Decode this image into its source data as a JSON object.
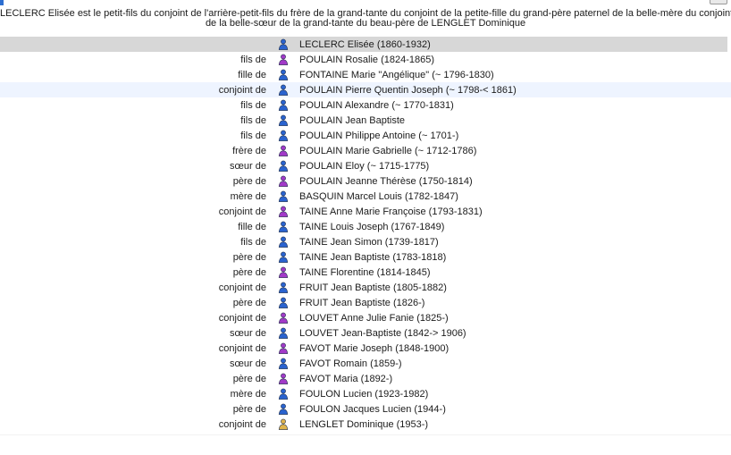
{
  "summary": {
    "line1": "LECLERC Elisée est le petit-fils du conjoint de l'arrière-petit-fils du frère de la grand-tante du conjoint de la petite-fille du grand-père paternel de la belle-mère du conjoint",
    "line2": "de la belle-sœur de la grand-tante du beau-père de LENGLET Dominique"
  },
  "colors": {
    "male_icon": "#2a63cf",
    "female_icon": "#a23ac8",
    "gold_icon": "#e0b54d",
    "selected_row": "#d7d7d7",
    "hover_row": "#eef4ff"
  },
  "rows": [
    {
      "relation": "",
      "name": "LECLERC Elisée (1860-1932)",
      "icon": "male-person-icon",
      "state": "selected"
    },
    {
      "relation": "fils de",
      "name": "POULAIN Rosalie (1824-1865)",
      "icon": "female-person-icon",
      "state": ""
    },
    {
      "relation": "fille de",
      "name": "FONTAINE Marie \"Angélique\" (~ 1796-1830)",
      "icon": "male-person-icon",
      "state": ""
    },
    {
      "relation": "conjoint de",
      "name": "POULAIN Pierre Quentin Joseph (~ 1798-< 1861)",
      "icon": "male-person-icon",
      "state": "hovered"
    },
    {
      "relation": "fils de",
      "name": "POULAIN Alexandre (~ 1770-1831)",
      "icon": "male-person-icon",
      "state": ""
    },
    {
      "relation": "fils de",
      "name": "POULAIN Jean Baptiste",
      "icon": "male-person-icon",
      "state": ""
    },
    {
      "relation": "fils de",
      "name": "POULAIN Philippe Antoine (~ 1701-)",
      "icon": "male-person-icon",
      "state": ""
    },
    {
      "relation": "frère de",
      "name": "POULAIN Marie Gabrielle (~ 1712-1786)",
      "icon": "female-person-icon",
      "state": ""
    },
    {
      "relation": "sœur de",
      "name": "POULAIN Eloy (~ 1715-1775)",
      "icon": "male-person-icon",
      "state": ""
    },
    {
      "relation": "père de",
      "name": "POULAIN Jeanne Thérèse (1750-1814)",
      "icon": "female-person-icon",
      "state": ""
    },
    {
      "relation": "mère de",
      "name": "BASQUIN Marcel Louis (1782-1847)",
      "icon": "male-person-icon",
      "state": ""
    },
    {
      "relation": "conjoint de",
      "name": "TAINE Anne Marie Françoise (1793-1831)",
      "icon": "female-person-icon",
      "state": ""
    },
    {
      "relation": "fille de",
      "name": "TAINE Louis Joseph (1767-1849)",
      "icon": "male-person-icon",
      "state": ""
    },
    {
      "relation": "fils de",
      "name": "TAINE Jean Simon (1739-1817)",
      "icon": "male-person-icon",
      "state": ""
    },
    {
      "relation": "père de",
      "name": "TAINE Jean Baptiste (1783-1818)",
      "icon": "male-person-icon",
      "state": ""
    },
    {
      "relation": "père de",
      "name": "TAINE Florentine (1814-1845)",
      "icon": "female-person-icon",
      "state": ""
    },
    {
      "relation": "conjoint de",
      "name": "FRUIT Jean Baptiste (1805-1882)",
      "icon": "male-person-icon",
      "state": ""
    },
    {
      "relation": "père de",
      "name": "FRUIT Jean Baptiste (1826-)",
      "icon": "male-person-icon",
      "state": ""
    },
    {
      "relation": "conjoint de",
      "name": "LOUVET Anne Julie Fanie (1825-)",
      "icon": "female-person-icon",
      "state": ""
    },
    {
      "relation": "sœur de",
      "name": "LOUVET Jean-Baptiste (1842-> 1906)",
      "icon": "male-person-icon",
      "state": ""
    },
    {
      "relation": "conjoint de",
      "name": "FAVOT Marie Joseph (1848-1900)",
      "icon": "female-person-icon",
      "state": ""
    },
    {
      "relation": "sœur de",
      "name": "FAVOT Romain (1859-)",
      "icon": "male-person-icon",
      "state": ""
    },
    {
      "relation": "père de",
      "name": "FAVOT Maria (1892-)",
      "icon": "female-person-icon",
      "state": ""
    },
    {
      "relation": "mère de",
      "name": "FOULON Lucien (1923-1982)",
      "icon": "male-person-icon",
      "state": ""
    },
    {
      "relation": "père de",
      "name": "FOULON Jacques Lucien (1944-)",
      "icon": "male-person-icon",
      "state": ""
    },
    {
      "relation": "conjoint de",
      "name": "LENGLET Dominique (1953-)",
      "icon": "gold-person-icon",
      "state": ""
    }
  ]
}
